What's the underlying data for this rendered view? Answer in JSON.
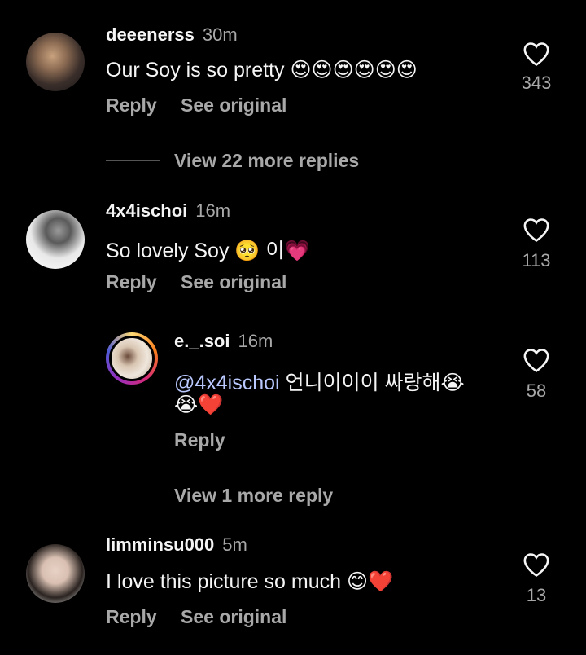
{
  "comments": [
    {
      "username": "deeenerss",
      "time": "30m",
      "text": "Our Soy is so pretty",
      "emojis": [
        "😍",
        "😍",
        "😍",
        "😍",
        "😍",
        "😍"
      ],
      "reply": "Reply",
      "see_original": "See original",
      "likes": "343",
      "view_more": "View 22 more replies"
    },
    {
      "username": "4x4ischoi",
      "time": "16m",
      "text": "So lovely Soy",
      "emoji1": "🥺",
      "text_after": "이",
      "emoji2": "💗",
      "reply": "Reply",
      "see_original": "See original",
      "likes": "113"
    },
    {
      "username": "e._.soi",
      "time": "16m",
      "mention": "@4x4ischoi",
      "text": "언니이이이 싸랑해",
      "emoji1": "😭",
      "line2_emoji1": "😭",
      "line2_emoji2": "❤️",
      "reply": "Reply",
      "likes": "58",
      "view_more": "View 1 more reply"
    },
    {
      "username": "limminsu000",
      "time": "5m",
      "text": "I love this picture so much",
      "emoji1": "😊",
      "emoji2": "❤️",
      "reply": "Reply",
      "see_original": "See original",
      "likes": "13"
    }
  ],
  "icons": {
    "like": "heart-outline-icon"
  },
  "colors": {
    "background": "#000000",
    "secondary_text": "#a8a8a8",
    "mention": "#b9c8ff"
  }
}
